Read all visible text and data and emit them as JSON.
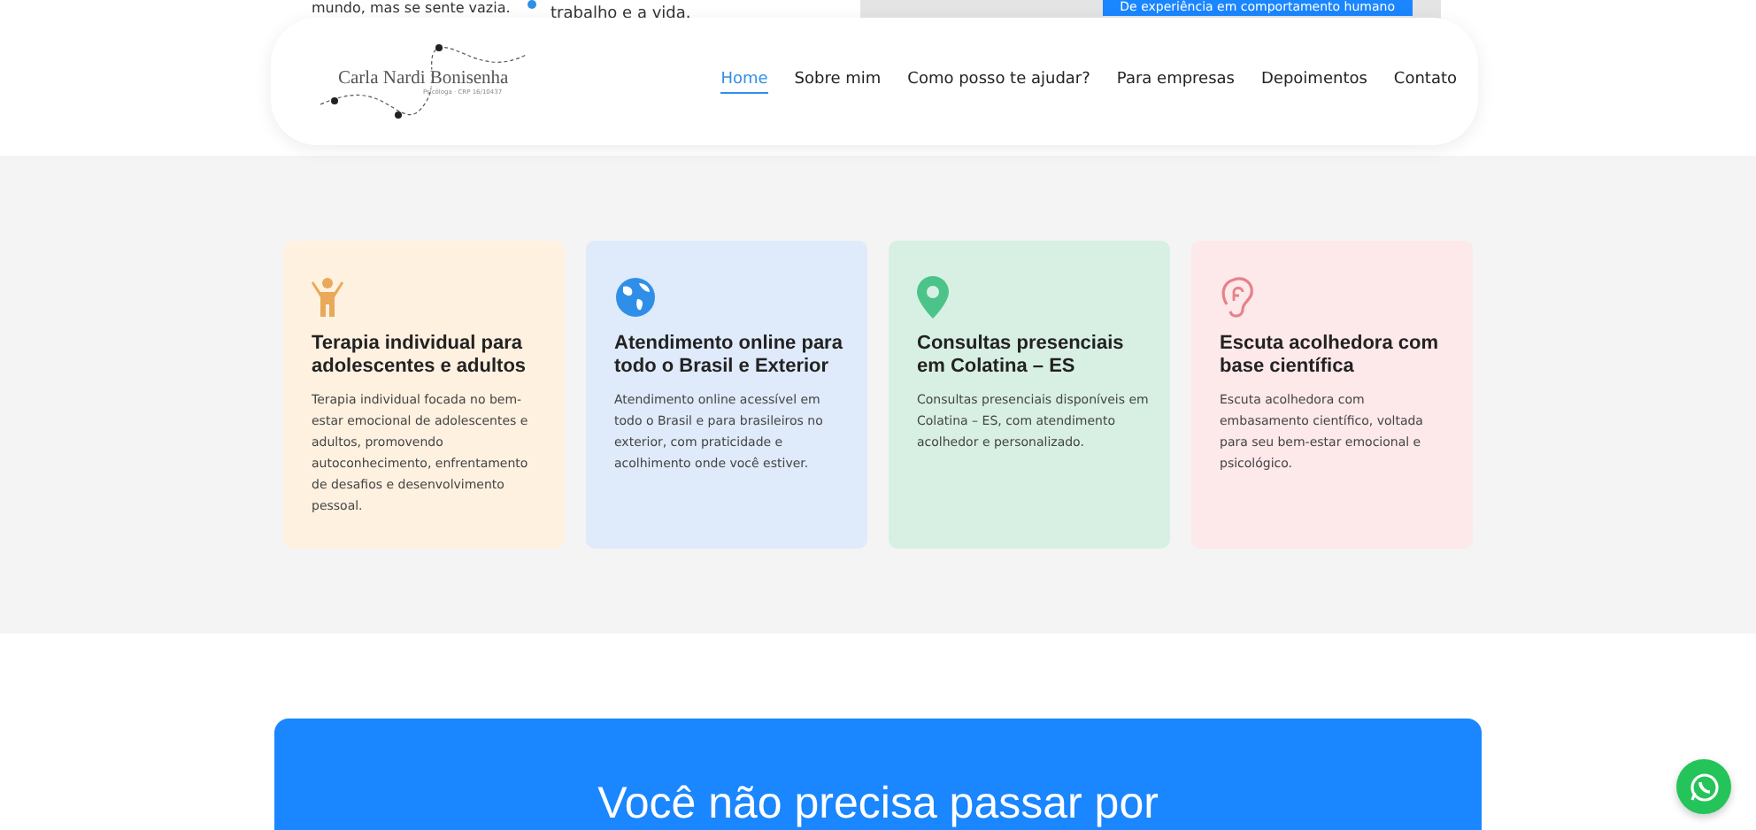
{
  "behind_header": {
    "left_text": "mundo, mas se sente vazia.",
    "middle_text": "trabalho e a vida.",
    "badge": "De experiência em comportamento humano"
  },
  "header": {
    "logo": {
      "name": "Carla Nardi Bonisenha",
      "subtitle": "Psicóloga · CRP 16/10437"
    },
    "nav": [
      {
        "label": "Home",
        "selected": true
      },
      {
        "label": "Sobre mim",
        "selected": false
      },
      {
        "label": "Como posso te ajudar?",
        "selected": false
      },
      {
        "label": "Para empresas",
        "selected": false
      },
      {
        "label": "Depoimentos",
        "selected": false
      },
      {
        "label": "Contato",
        "selected": false
      }
    ]
  },
  "services": [
    {
      "kind": "person",
      "color": "#fff1e0",
      "title": "Terapia individual para adolescentes e adultos",
      "text": "Terapia individual focada no bem-estar emocional de adolescentes e adultos, promovendo autoconhecimento, enfrentamento de desafios e desenvolvimento pessoal."
    },
    {
      "kind": "globe",
      "color": "#dfeafa",
      "title": "Atendimento online para todo o Brasil e Exterior",
      "text": "Atendimento online acessível em todo o Brasil e para brasileiros no exterior, com praticidade e acolhimento onde você estiver."
    },
    {
      "kind": "pin",
      "color": "#d8f0e4",
      "title": "Consultas presenciais em Colatina – ES",
      "text": "Consultas presenciais disponíveis em Colatina – ES, com atendimento acolhedor e personalizado."
    },
    {
      "kind": "ear",
      "color": "#fde8ea",
      "title": "Escuta acolhedora com base científica",
      "text": "Escuta acolhedora com embasamento científico, voltada para seu bem-estar emocional e psicológico."
    }
  ],
  "banner": {
    "heading": "Você não precisa passar por"
  }
}
